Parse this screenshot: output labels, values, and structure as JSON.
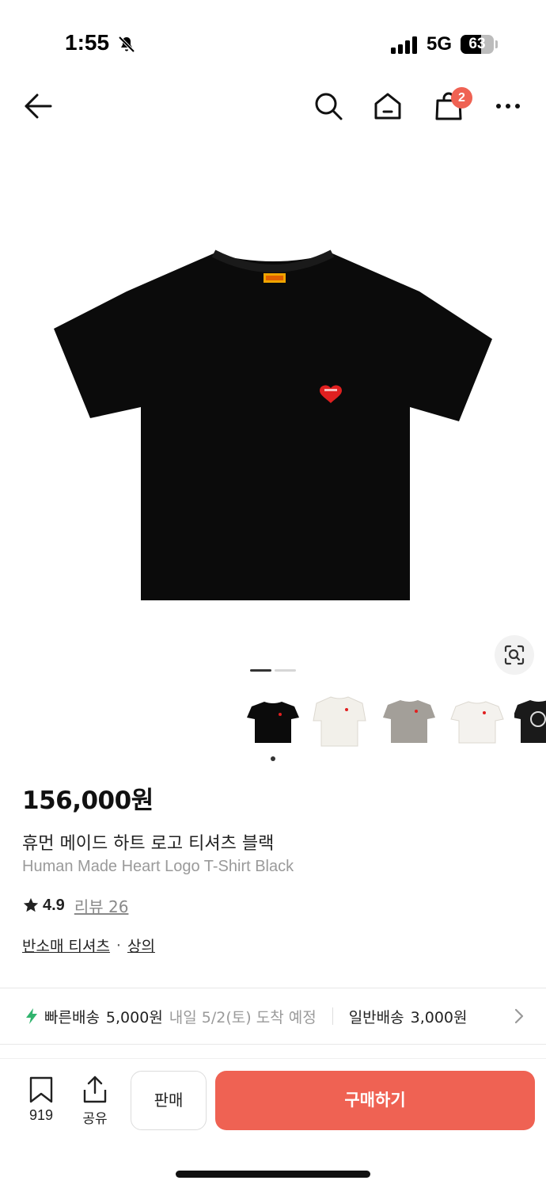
{
  "status_bar": {
    "time": "1:55",
    "network": "5G",
    "battery_level": "63",
    "battery_fraction": 0.63
  },
  "nav": {
    "back_icon": "arrow-left-icon",
    "search_icon": "search-icon",
    "home_icon": "home-icon",
    "cart_icon": "shopping-bag-icon",
    "cart_badge": "2",
    "more_icon": "more-dots-icon"
  },
  "gallery": {
    "current_page": 1,
    "total_pages": 2,
    "lens_icon": "image-search-icon",
    "thumbnails": [
      {
        "color": "black",
        "selected": true
      },
      {
        "color": "white",
        "selected": false
      },
      {
        "color": "gray",
        "selected": false
      },
      {
        "color": "white",
        "selected": false
      },
      {
        "color": "black",
        "selected": false
      }
    ]
  },
  "product": {
    "price": "156,000원",
    "name_ko": "휴먼 메이드 하트 로고 티셔츠 블랙",
    "name_en": "Human Made Heart Logo T-Shirt Black",
    "rating": "4.9",
    "review_label": "리뷰 26",
    "category_sub": "반소매 티셔츠",
    "category_sep": "·",
    "category_main": "상의"
  },
  "shipping": {
    "fast_label": "빠른배송",
    "fast_price": "5,000원",
    "fast_arrival": "내일 5/2(토) 도착 예정",
    "normal_label": "일반배송",
    "normal_price": "3,000원"
  },
  "bottom_bar": {
    "wish_count": "919",
    "share_label": "공유",
    "sell_label": "판매",
    "buy_label": "구매하기"
  },
  "colors": {
    "accent": "#ef6253",
    "fast_bolt": "#31b46e",
    "text_muted": "#9a9a9a"
  }
}
